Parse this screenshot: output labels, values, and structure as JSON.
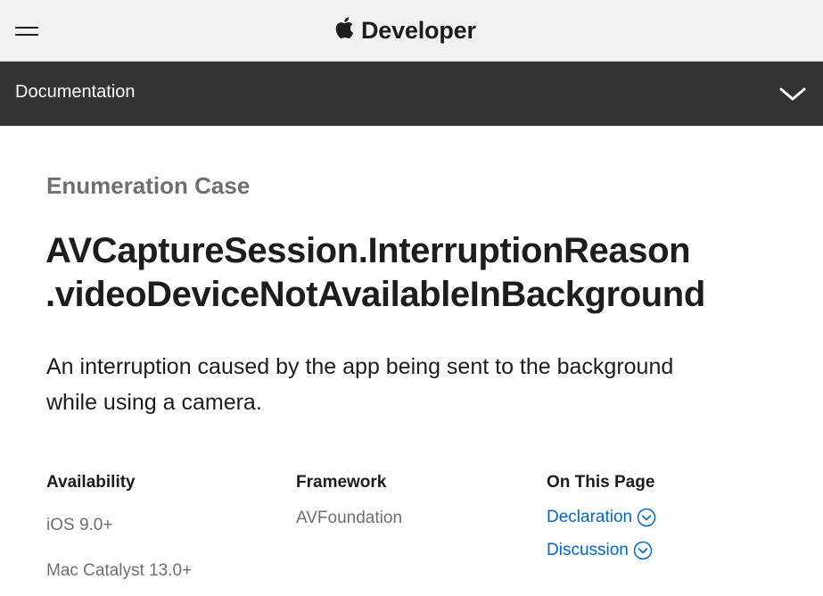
{
  "global_nav": {
    "menu_icon": "hamburger-menu-icon",
    "logo_icon": "apple-logo-icon",
    "brand_label": "Developer"
  },
  "local_nav": {
    "title": "Documentation",
    "toggle_icon": "chevron-down-icon"
  },
  "main": {
    "eyebrow": "Enumeration Case",
    "title_lines": [
      "AVCaptureSession.InterruptionReason",
      ".videoDeviceNotAvailableInBackground"
    ],
    "abstract_lines": [
      "An interruption caused by the app being sent to the background",
      "while using a camera."
    ]
  },
  "summary": {
    "availability": {
      "heading": "Availability",
      "items": [
        "iOS 9.0+",
        "Mac Catalyst 13.0+"
      ]
    },
    "framework": {
      "heading": "Framework",
      "value": "AVFoundation"
    },
    "on_this_page": {
      "heading": "On This Page",
      "links": [
        {
          "label": "Declaration",
          "icon": "circle-chevron-down-icon"
        },
        {
          "label": "Discussion",
          "icon": "circle-chevron-down-icon"
        }
      ]
    }
  },
  "colors": {
    "global_nav_bg": "#f2f2f2",
    "local_nav_bg": "#333333",
    "link": "#0066cc",
    "secondary_text": "#6e6e73",
    "primary_text": "#1d1d1f"
  }
}
